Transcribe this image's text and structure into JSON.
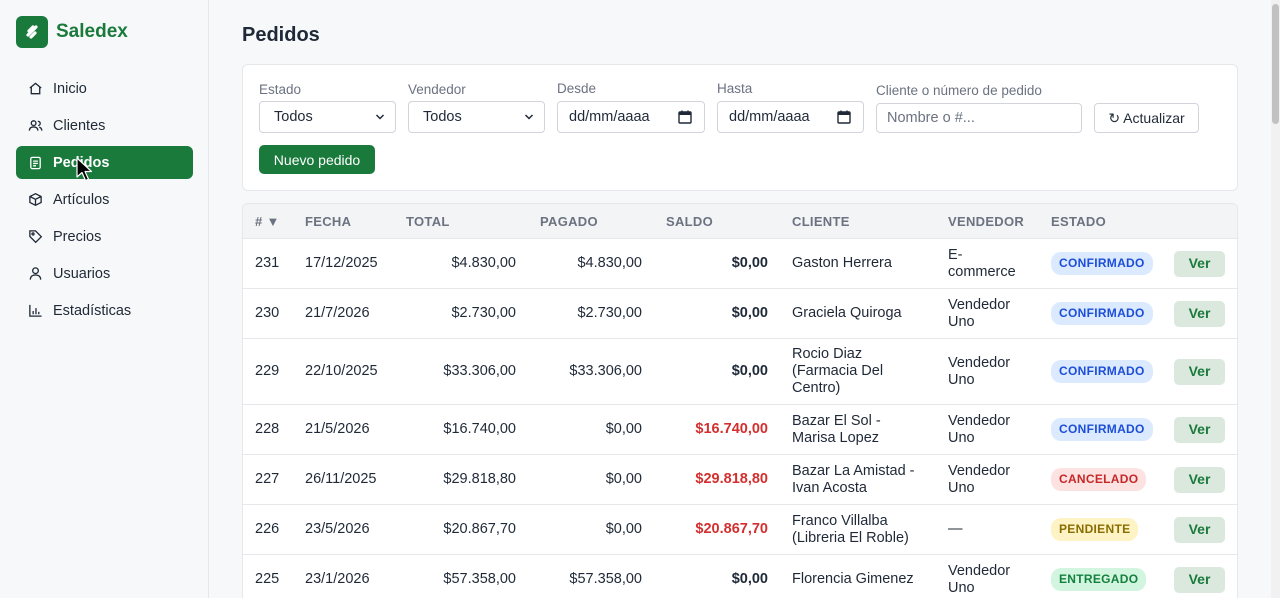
{
  "app": {
    "name": "Saledex"
  },
  "sidebar": {
    "items": [
      {
        "label": "Inicio",
        "icon": "home-icon"
      },
      {
        "label": "Clientes",
        "icon": "users-icon"
      },
      {
        "label": "Pedidos",
        "icon": "clipboard-icon",
        "active": true
      },
      {
        "label": "Artículos",
        "icon": "box-icon"
      },
      {
        "label": "Precios",
        "icon": "tag-icon"
      },
      {
        "label": "Usuarios",
        "icon": "user-icon"
      },
      {
        "label": "Estadísticas",
        "icon": "chart-icon"
      }
    ]
  },
  "page": {
    "title": "Pedidos"
  },
  "filters": {
    "estado_label": "Estado",
    "estado_value": "Todos",
    "vendedor_label": "Vendedor",
    "vendedor_value": "Todos",
    "desde_label": "Desde",
    "desde_value": "dd/mm/aaaa",
    "hasta_label": "Hasta",
    "hasta_value": "dd/mm/aaaa",
    "search_label": "Cliente o número de pedido",
    "search_placeholder": "Nombre o #...",
    "refresh_label": "↻ Actualizar",
    "new_label": "Nuevo pedido"
  },
  "table": {
    "headers": {
      "num": "# ▼",
      "fecha": "FECHA",
      "total": "TOTAL",
      "pagado": "PAGADO",
      "saldo": "SALDO",
      "cliente": "CLIENTE",
      "vendedor": "VENDEDOR",
      "estado": "ESTADO"
    },
    "view_label": "Ver",
    "rows": [
      {
        "num": "231",
        "fecha": "17/12/2025",
        "total": "$4.830,00",
        "pagado": "$4.830,00",
        "saldo": "$0,00",
        "cliente": "Gaston Herrera",
        "vendedor": "E-commerce",
        "estado": "CONFIRMADO"
      },
      {
        "num": "230",
        "fecha": "21/7/2026",
        "total": "$2.730,00",
        "pagado": "$2.730,00",
        "saldo": "$0,00",
        "cliente": "Graciela Quiroga",
        "vendedor": "Vendedor Uno",
        "estado": "CONFIRMADO"
      },
      {
        "num": "229",
        "fecha": "22/10/2025",
        "total": "$33.306,00",
        "pagado": "$33.306,00",
        "saldo": "$0,00",
        "cliente": "Rocio Diaz (Farmacia Del Centro)",
        "vendedor": "Vendedor Uno",
        "estado": "CONFIRMADO"
      },
      {
        "num": "228",
        "fecha": "21/5/2026",
        "total": "$16.740,00",
        "pagado": "$0,00",
        "saldo": "$16.740,00",
        "cliente": "Bazar El Sol - Marisa Lopez",
        "vendedor": "Vendedor Uno",
        "estado": "CONFIRMADO"
      },
      {
        "num": "227",
        "fecha": "26/11/2025",
        "total": "$29.818,80",
        "pagado": "$0,00",
        "saldo": "$29.818,80",
        "cliente": "Bazar La Amistad - Ivan Acosta",
        "vendedor": "Vendedor Uno",
        "estado": "CANCELADO"
      },
      {
        "num": "226",
        "fecha": "23/5/2026",
        "total": "$20.867,70",
        "pagado": "$0,00",
        "saldo": "$20.867,70",
        "cliente": "Franco Villalba (Libreria El Roble)",
        "vendedor": "—",
        "estado": "PENDIENTE"
      },
      {
        "num": "225",
        "fecha": "23/1/2026",
        "total": "$57.358,00",
        "pagado": "$57.358,00",
        "saldo": "$0,00",
        "cliente": "Florencia Gimenez",
        "vendedor": "Vendedor Uno",
        "estado": "ENTREGADO"
      }
    ]
  },
  "colors": {
    "brand": "#1a7a3c",
    "saldo_due": "#d32f2f",
    "confirmado": "#1d4ed8",
    "cancelado": "#c62828",
    "pendiente": "#8a6d00",
    "entregado": "#15803d"
  }
}
